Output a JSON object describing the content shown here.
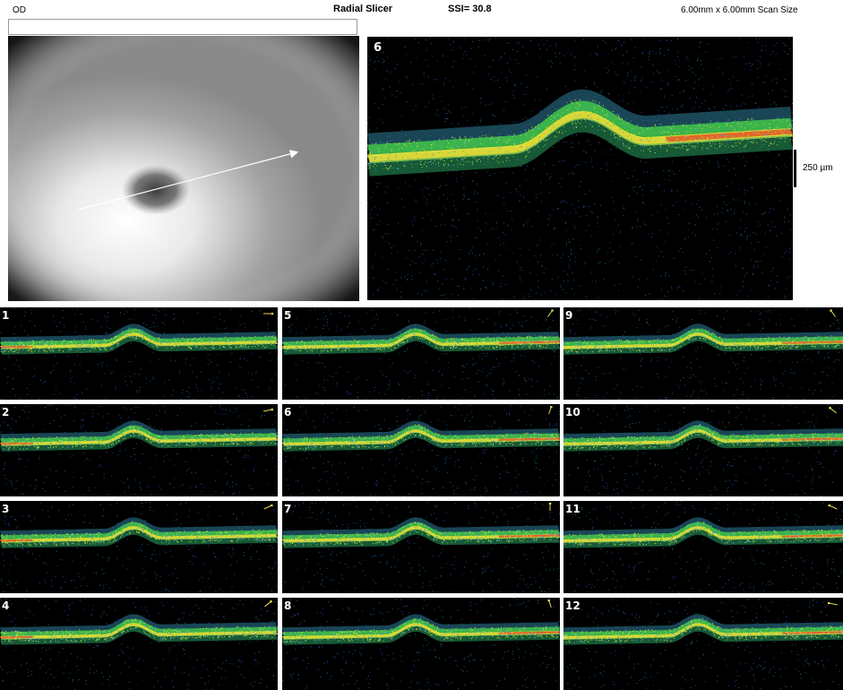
{
  "header": {
    "eye": "OD",
    "title": "Radial Slicer",
    "ssi": "SSI= 30.8",
    "scan_size": "6.00mm x 6.00mm Scan Size"
  },
  "main_scan": {
    "number": "6"
  },
  "scale": {
    "label": "250 µm"
  },
  "thumbnails": [
    {
      "number": "1",
      "angle": 0
    },
    {
      "number": "2",
      "angle": 15
    },
    {
      "number": "3",
      "angle": 30
    },
    {
      "number": "4",
      "angle": 45
    },
    {
      "number": "5",
      "angle": 60
    },
    {
      "number": "6",
      "angle": 75
    },
    {
      "number": "7",
      "angle": 90
    },
    {
      "number": "8",
      "angle": 105
    },
    {
      "number": "9",
      "angle": 120
    },
    {
      "number": "10",
      "angle": 135
    },
    {
      "number": "11",
      "angle": 150
    },
    {
      "number": "12",
      "angle": 165
    }
  ],
  "colors": {
    "arrow": "#e8d650",
    "band_yellow": "#e8e23c",
    "band_green": "#39c64a",
    "band_orange": "#e3532a",
    "speckle_blue": "#3a6fe0"
  }
}
